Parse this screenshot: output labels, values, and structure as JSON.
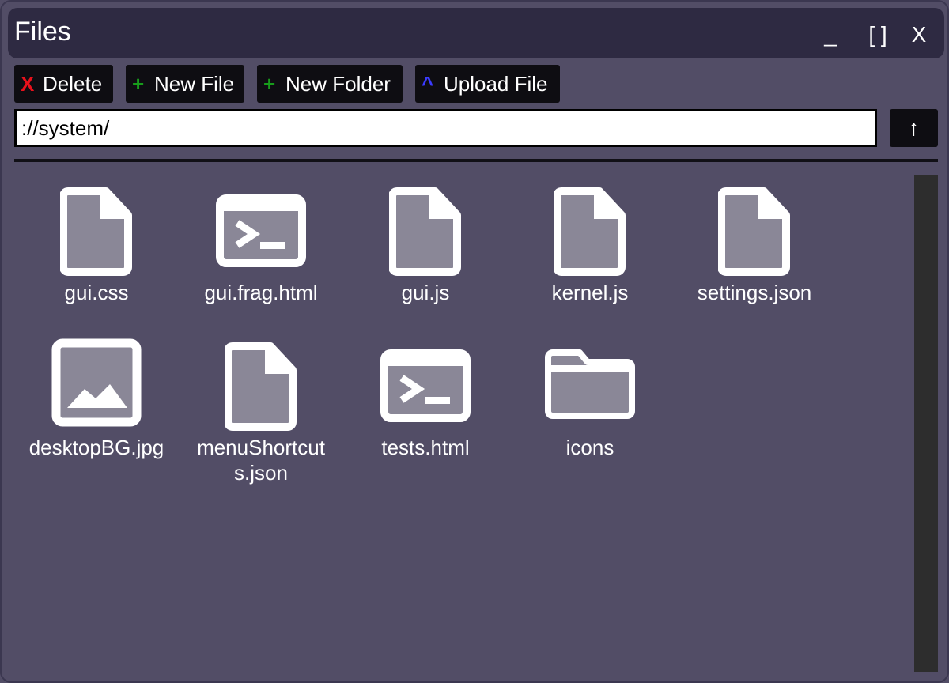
{
  "window": {
    "title": "Files",
    "controls": {
      "minimize": "_",
      "maximize": "[ ]",
      "close": "X"
    }
  },
  "toolbar": {
    "delete": {
      "glyph": "X",
      "label": "Delete",
      "glyph_color": "#e8111b"
    },
    "new_file": {
      "glyph": "+",
      "label": "New File",
      "glyph_color": "#179c1b"
    },
    "new_folder": {
      "glyph": "+",
      "label": "New Folder",
      "glyph_color": "#179c1b"
    },
    "upload_file": {
      "glyph": "^",
      "label": "Upload File",
      "glyph_color": "#3b3bff"
    }
  },
  "path": {
    "value": "://system/",
    "up_button": "↑"
  },
  "files": [
    {
      "name": "gui.css",
      "icon": "file-icon"
    },
    {
      "name": "gui.frag.html",
      "icon": "terminal-icon"
    },
    {
      "name": "gui.js",
      "icon": "file-icon"
    },
    {
      "name": "kernel.js",
      "icon": "file-icon"
    },
    {
      "name": "settings.json",
      "icon": "file-icon"
    },
    {
      "name": "desktopBG.jpg",
      "icon": "image-icon"
    },
    {
      "name": "menuShortcuts.json",
      "icon": "file-icon"
    },
    {
      "name": "tests.html",
      "icon": "terminal-icon"
    },
    {
      "name": "icons",
      "icon": "folder-icon"
    }
  ],
  "colors": {
    "window_bg": "#524d66",
    "titlebar_bg": "#2e2a42",
    "button_bg": "#0e0d12",
    "icon_outline": "#ffffff",
    "icon_fill": "#8a8797",
    "scrollbar": "#2d2d2d"
  }
}
